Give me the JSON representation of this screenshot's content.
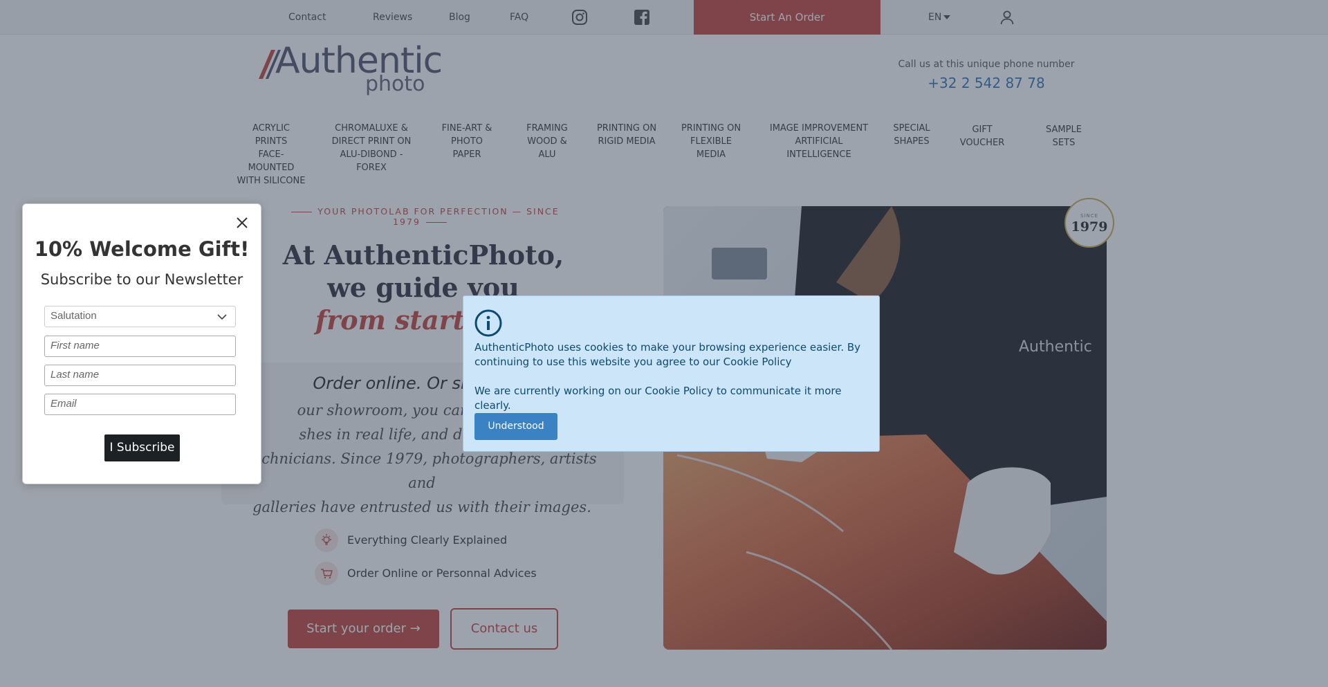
{
  "topbar": {
    "links": [
      "Contact",
      "Reviews",
      "Blog",
      "FAQ"
    ],
    "social_icons": [
      "instagram-icon",
      "facebook-icon"
    ],
    "order_button": "Start An Order",
    "language": "EN",
    "account_icon": "user-icon"
  },
  "header": {
    "logo_text": "Authentic",
    "logo_subtext": "photo",
    "call_label": "Call us at this unique phone number",
    "phone": "+32 2 542 87 78"
  },
  "nav": {
    "items": [
      "ACRYLIC PRINTS\nFACE-MOUNTED\nWITH SILICONE",
      "CHROMALUXE &\nDIRECT PRINT ON\nALU-DIBOND - FOREX",
      "FINE-ART &\nPHOTO PAPER",
      "FRAMING\nWOOD & ALU",
      "PRINTING ON\nRIGID MEDIA",
      "PRINTING ON\nFLEXIBLE MEDIA",
      "IMAGE IMPROVEMENT\nARTIFICIAL INTELLIGENCE",
      "SPECIAL\nSHAPES",
      "GIFT VOUCHER",
      "SAMPLE SETS"
    ]
  },
  "hero": {
    "tagline": "YOUR PHOTOLAB FOR PERFECTION — SINCE 1979",
    "headline_line1": "At AuthenticPhoto,",
    "headline_line2": "we guide you",
    "headline_accent": "from start to p",
    "quote_title": "Order online. Or simply co",
    "quote_body": "our showroom, you can see our m\nshes in real life, and discuss your\ntechnicians. Since 1979, photographers, artists and\ngalleries have entrusted us with their images.",
    "features": [
      {
        "icon": "lightbulb-icon",
        "label": "Everything Clearly Explained"
      },
      {
        "icon": "cart-icon",
        "label": "Order Online or Personnal Advices"
      }
    ],
    "primary_button": "Start your order →",
    "secondary_button": "Contact us",
    "badge_small": "SINCE",
    "badge_year": "1979",
    "photo_watermark": "Authentic"
  },
  "newsletter": {
    "title": "10% Welcome Gift!",
    "subtitle": "Subscribe to our Newsletter",
    "salutation": "Salutation",
    "first_name_placeholder": "First name",
    "last_name_placeholder": "Last name",
    "email_placeholder": "Email",
    "submit": "I Subscribe"
  },
  "cookie": {
    "text1": "AuthenticPhoto uses cookies to make your browsing experience easier. By continuing to use this website you agree to our Cookie Policy",
    "text2": "We are currently working on our Cookie Policy to communicate it more clearly.",
    "button": "Understood"
  },
  "colors": {
    "brand_red": "#c0403a",
    "phone_blue": "#2f6fae",
    "cookie_bg": "#cde5f8",
    "overlay": "rgba(60,72,90,0.5)"
  }
}
